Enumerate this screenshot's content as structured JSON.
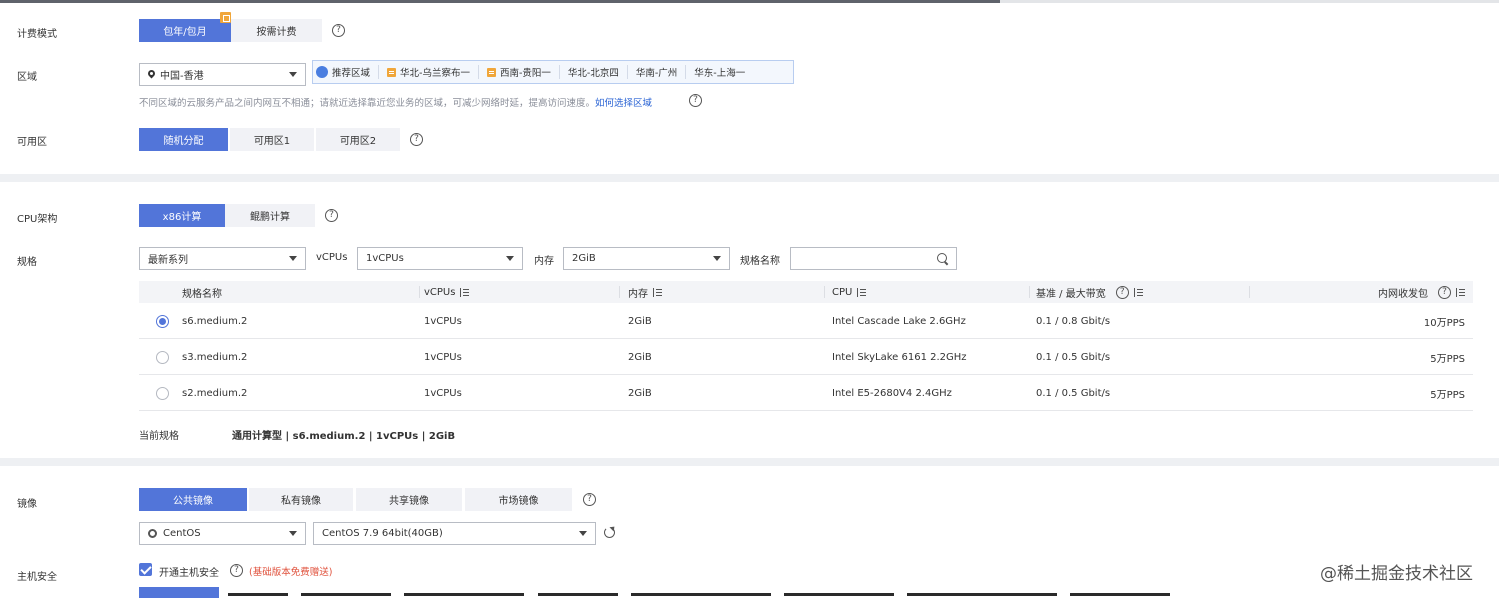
{
  "billing": {
    "label": "计费模式",
    "options": [
      "包年/包月",
      "按需计费"
    ],
    "selected": "包年/包月"
  },
  "region": {
    "label": "区域",
    "value": "中国-香港",
    "recommended_label": "推荐区域",
    "recommended": [
      "华北-乌兰察布一",
      "西南-贵阳一",
      "华北-北京四",
      "华南-广州",
      "华东-上海一"
    ],
    "hint": "不同区域的云服务产品之间内网互不相通；请就近选择靠近您业务的区域，可减少网络时延，提高访问速度。",
    "hint_link": "如何选择区域"
  },
  "az": {
    "label": "可用区",
    "options": [
      "随机分配",
      "可用区1",
      "可用区2"
    ],
    "selected": "随机分配"
  },
  "cpu_arch": {
    "label": "CPU架构",
    "options": [
      "x86计算",
      "鲲鹏计算"
    ],
    "selected": "x86计算"
  },
  "spec": {
    "label": "规格",
    "series": "最新系列",
    "vcpus_label": "vCPUs",
    "vcpus": "1vCPUs",
    "memory_label": "内存",
    "memory": "2GiB",
    "name_label": "规格名称",
    "name_placeholder": ""
  },
  "table": {
    "headers": {
      "name": "规格名称",
      "vcpus": "vCPUs",
      "memory": "内存",
      "cpu": "CPU",
      "bandwidth": "基准 / 最大带宽",
      "pps": "内网收发包"
    },
    "rows": [
      {
        "name": "s6.medium.2",
        "vcpus": "1vCPUs",
        "memory": "2GiB",
        "cpu": "Intel Cascade Lake 2.6GHz",
        "bandwidth": "0.1 / 0.8 Gbit/s",
        "pps": "10万PPS",
        "selected": true
      },
      {
        "name": "s3.medium.2",
        "vcpus": "1vCPUs",
        "memory": "2GiB",
        "cpu": "Intel SkyLake 6161 2.2GHz",
        "bandwidth": "0.1 / 0.5 Gbit/s",
        "pps": "5万PPS",
        "selected": false
      },
      {
        "name": "s2.medium.2",
        "vcpus": "1vCPUs",
        "memory": "2GiB",
        "cpu": "Intel E5-2680V4 2.4GHz",
        "bandwidth": "0.1 / 0.5 Gbit/s",
        "pps": "5万PPS",
        "selected": false
      }
    ]
  },
  "current_spec": {
    "label": "当前规格",
    "value": "通用计算型 | s6.medium.2 | 1vCPUs | 2GiB"
  },
  "image": {
    "label": "镜像",
    "tabs": [
      "公共镜像",
      "私有镜像",
      "共享镜像",
      "市场镜像"
    ],
    "selected_tab": "公共镜像",
    "os": "CentOS",
    "version": "CentOS 7.9 64bit(40GB)"
  },
  "host_security": {
    "label": "主机安全",
    "checkbox_label": "开通主机安全",
    "checked": true,
    "note": "(基础版本免费赠送)"
  },
  "watermark": "@稀土掘金技术社区",
  "colors": {
    "primary": "#5275d9",
    "note_red": "#e0523d",
    "link": "#2b64d4"
  }
}
